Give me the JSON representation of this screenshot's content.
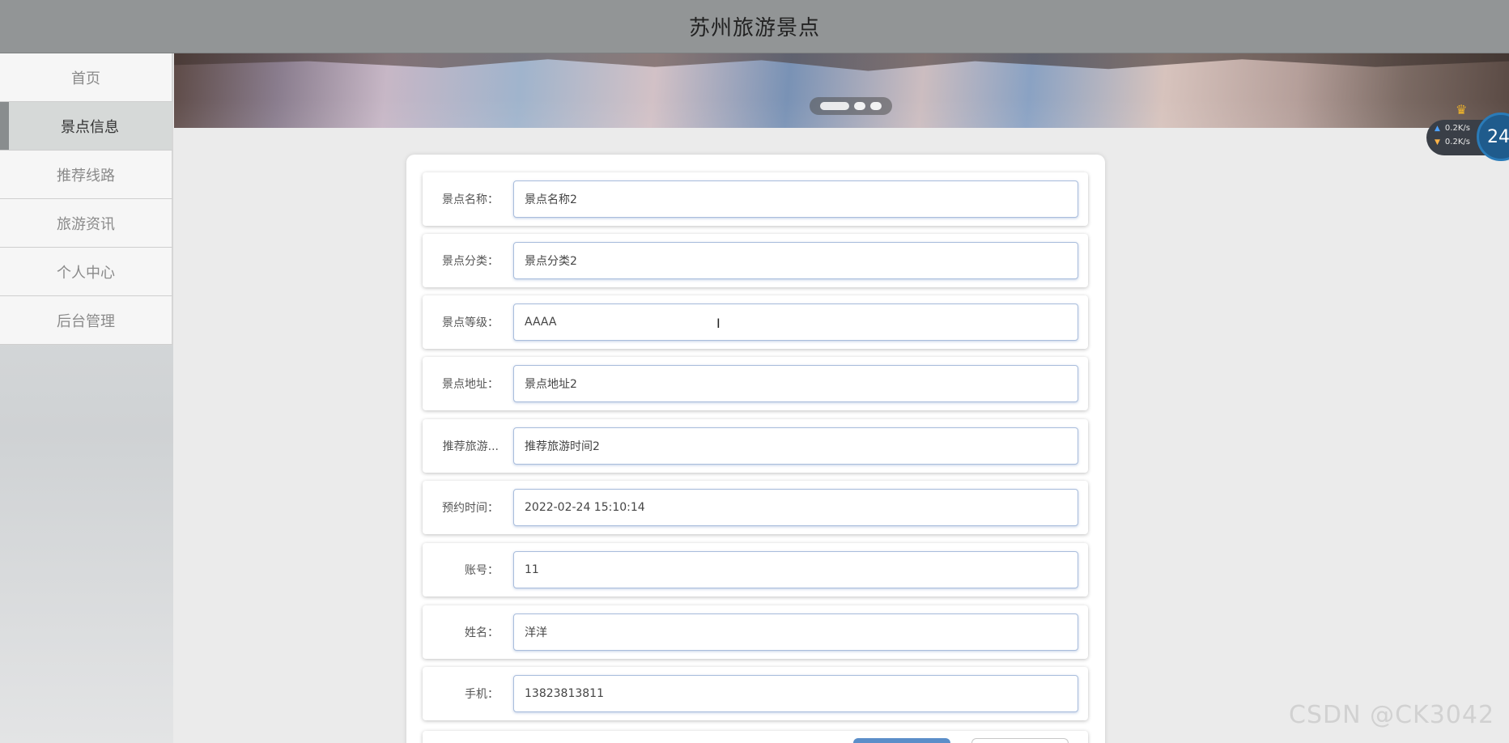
{
  "header": {
    "title": "苏州旅游景点"
  },
  "sidebar": {
    "items": [
      {
        "label": "首页"
      },
      {
        "label": "景点信息",
        "active": true
      },
      {
        "label": "推荐线路"
      },
      {
        "label": "旅游资讯"
      },
      {
        "label": "个人中心"
      },
      {
        "label": "后台管理"
      }
    ]
  },
  "banner": {
    "slide_count": 3,
    "active_slide": 1
  },
  "form": {
    "fields": [
      {
        "label": "景点名称：",
        "value": "景点名称2"
      },
      {
        "label": "景点分类：",
        "value": "景点分类2"
      },
      {
        "label": "景点等级：",
        "value": "AAAA"
      },
      {
        "label": "景点地址：",
        "value": "景点地址2"
      },
      {
        "label": "推荐旅游...",
        "value": "推荐旅游时间2"
      },
      {
        "label": "预约时间：",
        "value": "2022-02-24 15:10:14"
      },
      {
        "label": "账号：",
        "value": "11"
      },
      {
        "label": "姓名：",
        "value": "洋洋"
      },
      {
        "label": "手机：",
        "value": "13823813811"
      }
    ]
  },
  "speed_widget": {
    "upload": "0.2K/s",
    "download": "0.2K/s",
    "value": "24"
  },
  "watermark": "CSDN @CK3042",
  "colors": {
    "header_bg": "#929596",
    "active_nav_bg": "#d6d9d8",
    "field_border": "#a9bddc",
    "primary_button": "#5b8ec9"
  }
}
